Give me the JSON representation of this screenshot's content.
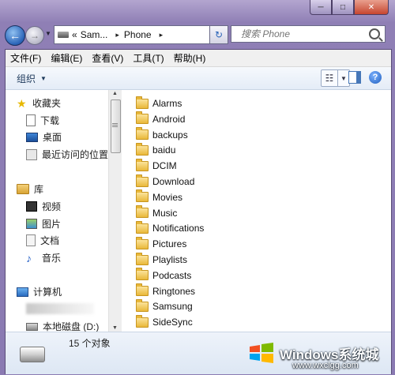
{
  "window": {
    "caption_buttons": {
      "minimize": "─",
      "maximize": "□",
      "close": "✕"
    }
  },
  "nav": {
    "back_glyph": "←",
    "forward_glyph": "→",
    "dropdown_glyph": "▼"
  },
  "address": {
    "chevron": "«",
    "crumbs": [
      "Sam...",
      "Phone"
    ],
    "separator": "▸",
    "refresh_glyph": "↻"
  },
  "search": {
    "placeholder": "搜索 Phone"
  },
  "menubar": {
    "items": [
      "文件(F)",
      "编辑(E)",
      "查看(V)",
      "工具(T)",
      "帮助(H)"
    ]
  },
  "commandbar": {
    "organize_label": "组织",
    "organize_arrow": "▼",
    "view_glyph": "☷",
    "view_dropdown": "▼",
    "help_glyph": "?"
  },
  "sidebar": {
    "favorites": {
      "label": "收藏夹",
      "items": [
        {
          "label": "下载",
          "icon": "download-icon"
        },
        {
          "label": "桌面",
          "icon": "desktop-icon"
        },
        {
          "label": "最近访问的位置",
          "icon": "recent-places-icon"
        }
      ]
    },
    "libraries": {
      "label": "库",
      "items": [
        {
          "label": "视频",
          "icon": "video-icon"
        },
        {
          "label": "图片",
          "icon": "pictures-icon"
        },
        {
          "label": "文档",
          "icon": "documents-icon"
        },
        {
          "label": "音乐",
          "icon": "music-icon"
        }
      ]
    },
    "computer": {
      "label": "计算机",
      "items": [
        {
          "label": "本地磁盘 (D:)",
          "icon": "hard-disk-icon"
        }
      ]
    }
  },
  "folders": [
    "Alarms",
    "Android",
    "backups",
    "baidu",
    "DCIM",
    "Download",
    "Movies",
    "Music",
    "Notifications",
    "Pictures",
    "Playlists",
    "Podcasts",
    "Ringtones",
    "Samsung",
    "SideSync"
  ],
  "status": {
    "item_count": "15 个对象"
  },
  "watermark": {
    "title": "Windows系统城",
    "url": "www.wxclgg.com"
  }
}
